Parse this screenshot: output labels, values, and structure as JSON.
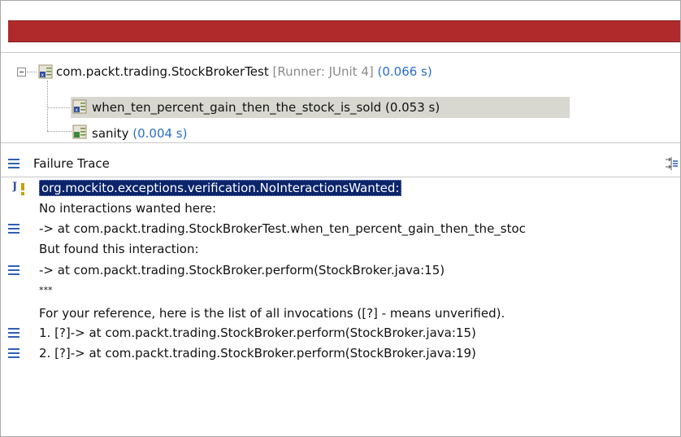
{
  "tree": {
    "suite": {
      "name": "com.packt.trading.StockBrokerTest",
      "runner": "[Runner: JUnit 4]",
      "time": "(0.066 s)"
    },
    "tests": [
      {
        "name": "when_ten_percent_gain_then_the_stock_is_sold",
        "time": "(0.053 s)",
        "status": "failed"
      },
      {
        "name": "sanity",
        "time": "(0.004 s)",
        "status": "passed"
      }
    ]
  },
  "failure_trace": {
    "title": "Failure Trace",
    "lines": [
      "org.mockito.exceptions.verification.NoInteractionsWanted:",
      "No interactions wanted here:",
      "-> at com.packt.trading.StockBrokerTest.when_ten_percent_gain_then_the_stoc",
      "But found this interaction:",
      "-> at com.packt.trading.StockBroker.perform(StockBroker.java:15)",
      "***",
      "For your reference, here is the list of all invocations ([?] - means unverified).",
      "1. [?]-> at com.packt.trading.StockBroker.perform(StockBroker.java:15)",
      "2. [?]-> at com.packt.trading.StockBroker.perform(StockBroker.java:19)"
    ]
  },
  "colors": {
    "progress_failed": "#b02a2c",
    "selection": "#d8d8d0",
    "highlight": "#0b246a",
    "time_text": "#2a6fc9"
  },
  "icons": [
    "collapse-icon",
    "test-suite-icon",
    "test-failed-icon",
    "test-passed-icon",
    "stack-frame-icon",
    "exception-icon",
    "filter-trace-icon"
  ]
}
